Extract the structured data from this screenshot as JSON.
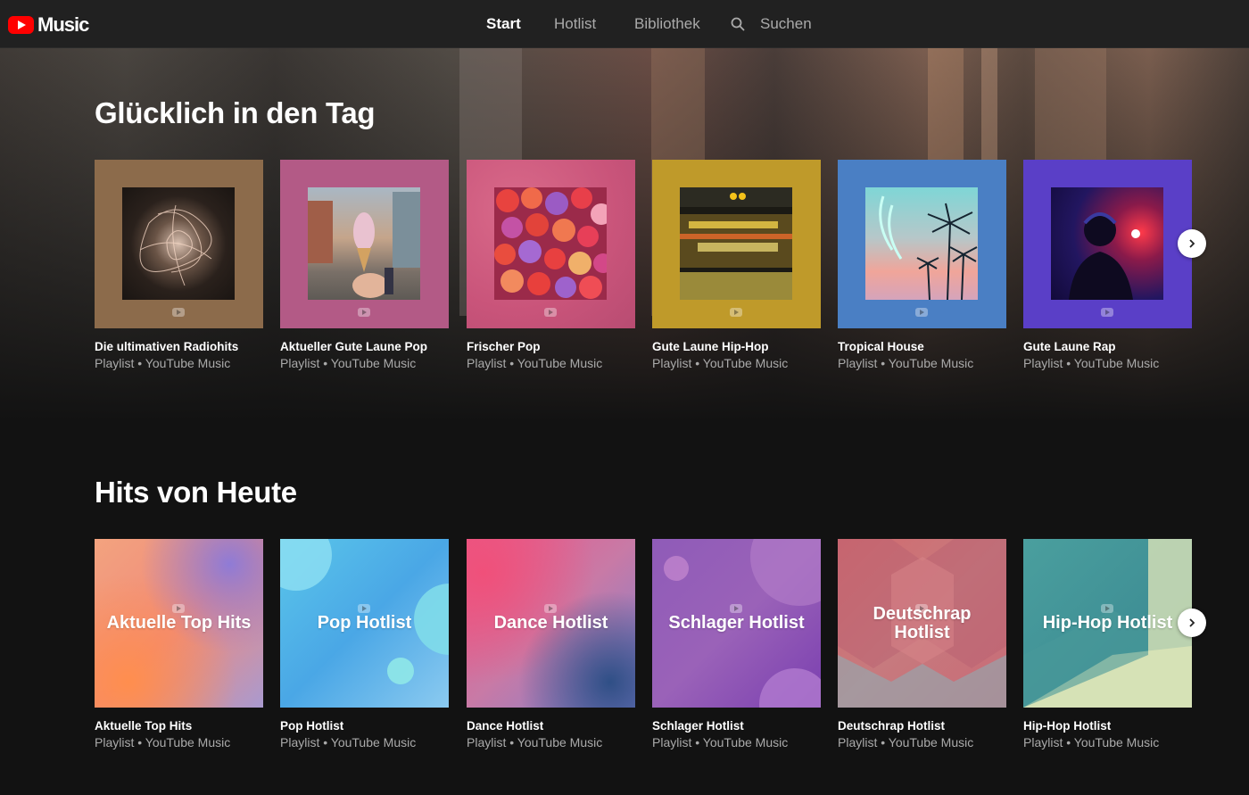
{
  "header": {
    "logo_text": "Music",
    "nav": {
      "start": "Start",
      "hotlist": "Hotlist",
      "bibliothek": "Bibliothek",
      "suchen": "Suchen"
    }
  },
  "sections": [
    {
      "title": "Glücklich in den Tag",
      "cards": [
        {
          "title": "Die ultimativen Radiohits",
          "subtitle": "Playlist • YouTube Music"
        },
        {
          "title": "Aktueller Gute Laune Pop",
          "subtitle": "Playlist • YouTube Music"
        },
        {
          "title": "Frischer Pop",
          "subtitle": "Playlist • YouTube Music"
        },
        {
          "title": "Gute Laune Hip-Hop",
          "subtitle": "Playlist • YouTube Music"
        },
        {
          "title": "Tropical House",
          "subtitle": "Playlist • YouTube Music"
        },
        {
          "title": "Gute Laune Rap",
          "subtitle": "Playlist • YouTube Music"
        }
      ]
    },
    {
      "title": "Hits von Heute",
      "cards": [
        {
          "title": "Aktuelle Top Hits",
          "subtitle": "Playlist • YouTube Music",
          "cover_text": "Aktuelle Top Hits"
        },
        {
          "title": "Pop Hotlist",
          "subtitle": "Playlist • YouTube Music",
          "cover_text": "Pop Hotlist"
        },
        {
          "title": "Dance Hotlist",
          "subtitle": "Playlist • YouTube Music",
          "cover_text": "Dance Hotlist"
        },
        {
          "title": "Schlager Hotlist",
          "subtitle": "Playlist • YouTube Music",
          "cover_text": "Schlager Hotlist"
        },
        {
          "title": "Deutschrap Hotlist",
          "subtitle": "Playlist • YouTube Music",
          "cover_text": "Deutschrap Hotlist"
        },
        {
          "title": "Hip-Hop Hotlist",
          "subtitle": "Playlist • YouTube Music",
          "cover_text": "Hip-Hop Hotlist"
        }
      ]
    }
  ]
}
